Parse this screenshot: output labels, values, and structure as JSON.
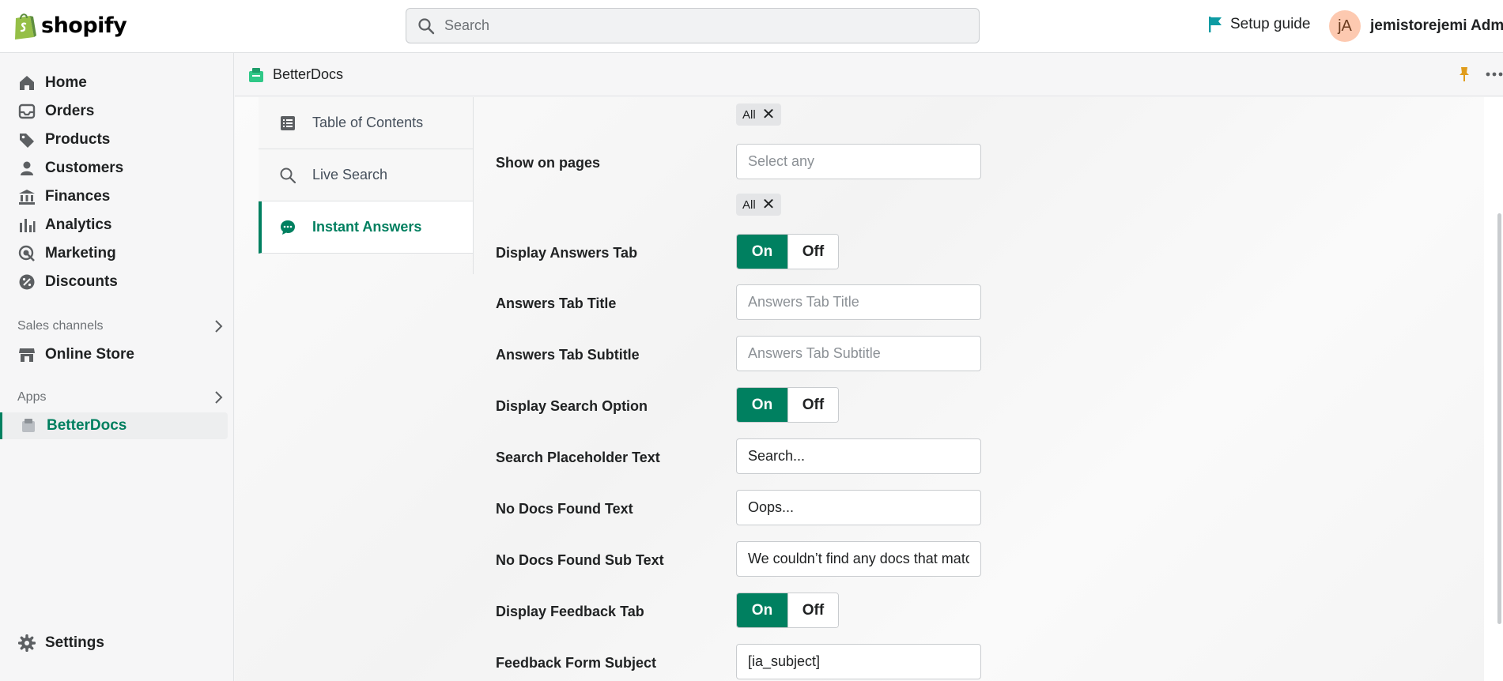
{
  "topbar": {
    "logo_text": "shopify",
    "search_placeholder": "Search",
    "setup_guide": "Setup guide",
    "user_initials": "jA",
    "user_name": "jemistorejemi Admin"
  },
  "sidebar": {
    "items": [
      {
        "label": "Home",
        "icon": "home-icon"
      },
      {
        "label": "Orders",
        "icon": "orders-icon"
      },
      {
        "label": "Products",
        "icon": "tag-icon"
      },
      {
        "label": "Customers",
        "icon": "person-icon"
      },
      {
        "label": "Finances",
        "icon": "bank-icon"
      },
      {
        "label": "Analytics",
        "icon": "bar-chart-icon"
      },
      {
        "label": "Marketing",
        "icon": "target-icon"
      },
      {
        "label": "Discounts",
        "icon": "discount-icon"
      }
    ],
    "sales_channels_label": "Sales channels",
    "online_store": "Online Store",
    "apps_label": "Apps",
    "betterdocs": "BetterDocs",
    "settings": "Settings"
  },
  "appbar": {
    "title": "BetterDocs"
  },
  "tabs": [
    {
      "label": "Table of Contents",
      "icon": "list-icon"
    },
    {
      "label": "Live Search",
      "icon": "search-icon"
    },
    {
      "label": "Instant Answers",
      "icon": "chat-icon",
      "active": true
    }
  ],
  "form": {
    "tag_all_1": "All",
    "show_on_pages_label": "Show on pages",
    "show_on_pages_placeholder": "Select any",
    "tag_all_2": "All",
    "display_answers_tab_label": "Display Answers Tab",
    "answers_tab_title_label": "Answers Tab Title",
    "answers_tab_title_placeholder": "Answers Tab Title",
    "answers_tab_subtitle_label": "Answers Tab Subtitle",
    "answers_tab_subtitle_placeholder": "Answers Tab Subtitle",
    "display_search_option_label": "Display Search Option",
    "search_placeholder_text_label": "Search Placeholder Text",
    "search_placeholder_text_value": "Search...",
    "no_docs_found_text_label": "No Docs Found Text",
    "no_docs_found_text_value": "Oops...",
    "no_docs_found_sub_text_label": "No Docs Found Sub Text",
    "no_docs_found_sub_text_value": "We couldn’t find any docs that match",
    "display_feedback_tab_label": "Display Feedback Tab",
    "feedback_form_subject_label": "Feedback Form Subject",
    "feedback_form_subject_value": "[ia_subject]",
    "toggle_on": "On",
    "toggle_off": "Off"
  },
  "colors": {
    "accent": "#008060",
    "setup_flag": "#0d9ba3",
    "pin": "#e09c1b",
    "avatar_bg": "#fdc9b0"
  }
}
